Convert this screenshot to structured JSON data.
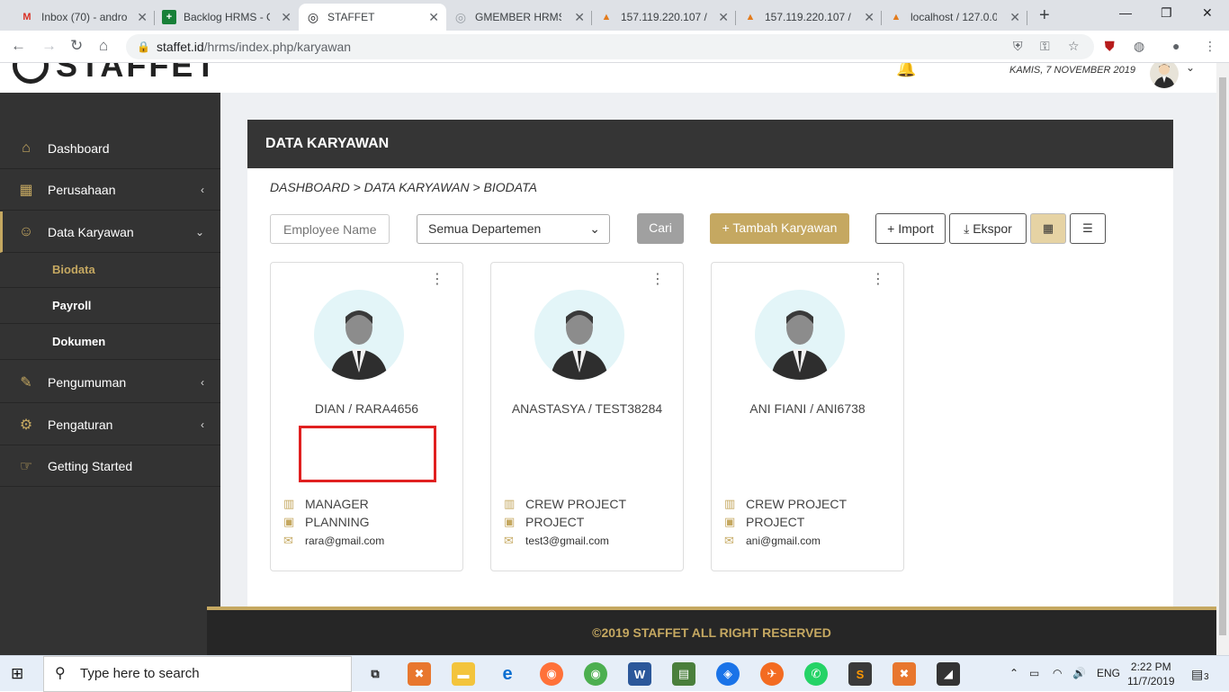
{
  "browser": {
    "tabs": [
      {
        "title": "Inbox (70) - andro",
        "icon": "gmail-icon",
        "glyph": "M",
        "color": "#d93025"
      },
      {
        "title": "Backlog HRMS - G",
        "icon": "sheets-icon",
        "glyph": "+",
        "color": "#188038"
      },
      {
        "title": "STAFFET",
        "icon": "staffet-icon",
        "glyph": "◎",
        "color": "#202124"
      },
      {
        "title": "GMEMBER HRMS",
        "icon": "gmember-icon",
        "glyph": "◎",
        "color": "#9aa0a6"
      },
      {
        "title": "157.119.220.107 /",
        "icon": "phpmyadmin-icon",
        "glyph": "▲",
        "color": "#e37b1c"
      },
      {
        "title": "157.119.220.107 /",
        "icon": "phpmyadmin-icon",
        "glyph": "▲",
        "color": "#e37b1c"
      },
      {
        "title": "localhost / 127.0.0",
        "icon": "phpmyadmin-icon",
        "glyph": "▲",
        "color": "#e37b1c"
      }
    ],
    "url_host": "staffet.id",
    "url_path": "/hrms/index.php/karyawan"
  },
  "header": {
    "logo_text": "STAFFET",
    "date": "KAMIS, 7 NOVEMBER 2019"
  },
  "sidebar": {
    "items": [
      {
        "label": "Dashboard",
        "icon": "home-icon",
        "glyph": "⌂"
      },
      {
        "label": "Perusahaan",
        "icon": "building-icon",
        "glyph": "▦"
      },
      {
        "label": "Data Karyawan",
        "icon": "users-icon",
        "glyph": "☺"
      },
      {
        "label": "Pengumuman",
        "icon": "megaphone-icon",
        "glyph": "✎"
      },
      {
        "label": "Pengaturan",
        "icon": "gear-icon",
        "glyph": "⚙"
      },
      {
        "label": "Getting Started",
        "icon": "hand-icon",
        "glyph": "☞"
      }
    ],
    "sub_items": [
      "Biodata",
      "Payroll",
      "Dokumen"
    ]
  },
  "main": {
    "title": "DATA KARYAWAN",
    "breadcrumb": "DASHBOARD > DATA KARYAWAN > BIODATA",
    "search_placeholder": "Employee Name",
    "department_selected": "Semua Departemen",
    "buttons": {
      "search": "Cari",
      "add": "+ Tambah Karyawan",
      "import": "+ Import",
      "export": "Ekspor"
    },
    "employees": [
      {
        "name": "DIAN / RARA4656",
        "position": "MANAGER",
        "department": "PLANNING",
        "email": "rara@gmail.com"
      },
      {
        "name": "ANASTASYA / TEST38284",
        "position": "CREW PROJECT",
        "department": "PROJECT",
        "email": "test3@gmail.com"
      },
      {
        "name": "ANI FIANI / ANI6738",
        "position": "CREW PROJECT",
        "department": "PROJECT",
        "email": "ani@gmail.com"
      }
    ]
  },
  "footer": {
    "text": "©2019 STAFFET ALL RIGHT RESERVED"
  },
  "taskbar": {
    "search_text": "Type here to search",
    "language": "ENG",
    "time": "2:22 PM",
    "date": "11/7/2019",
    "notifications": "3"
  },
  "colors": {
    "accent": "#c5a861",
    "sidebar_bg": "#333333",
    "header_bar": "#353535"
  }
}
